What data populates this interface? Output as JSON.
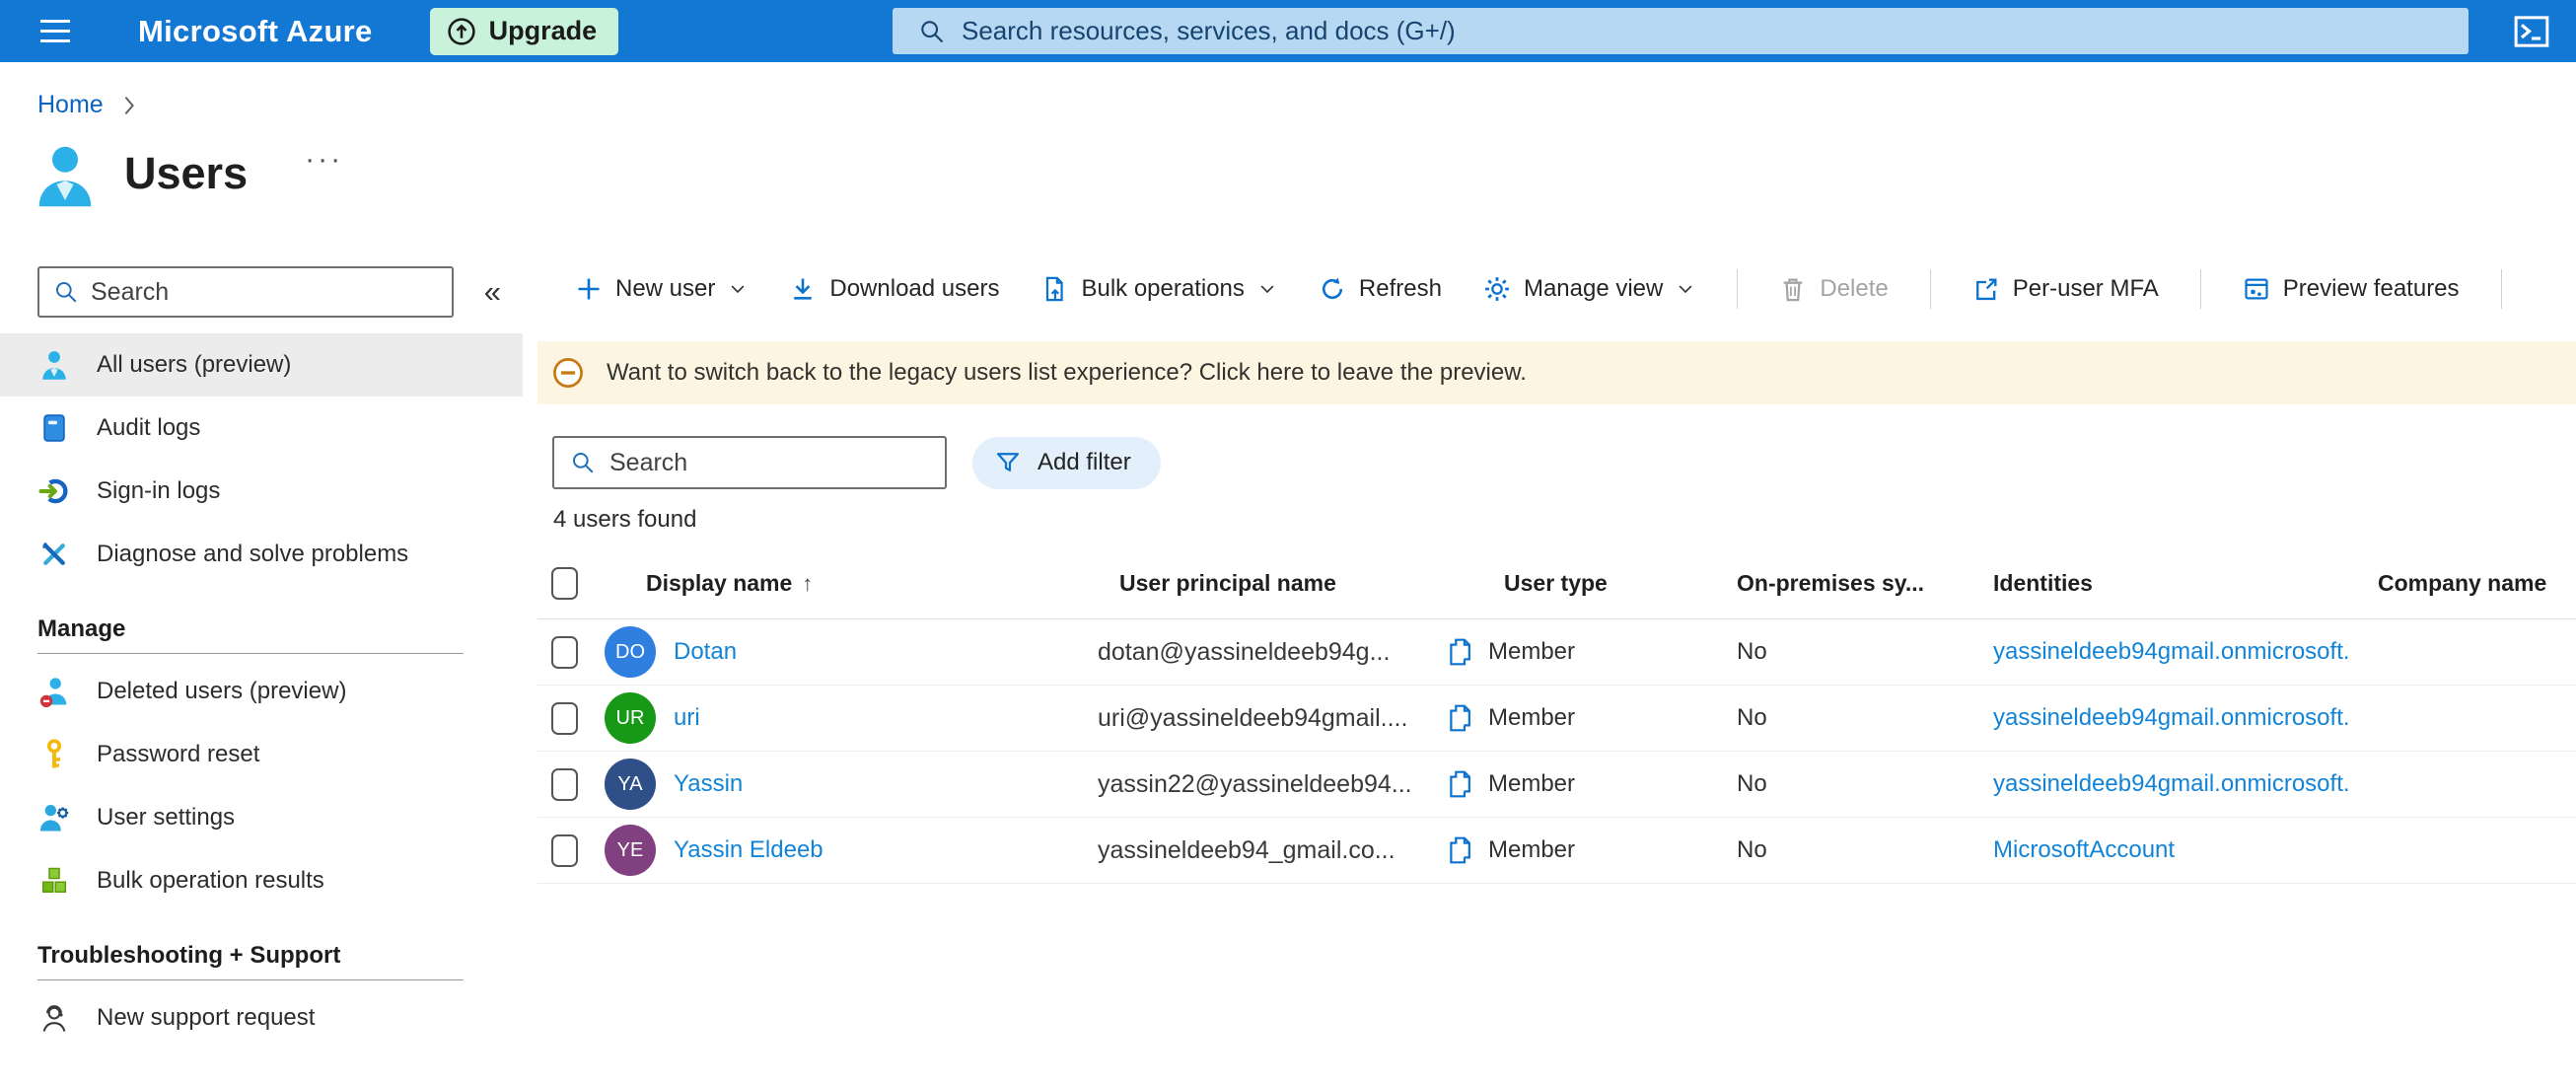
{
  "colors": {
    "topbar_bg": "#1377d4",
    "topbar_search_bg": "#b6d8f2",
    "upgrade_bg": "#c9f2da",
    "accent_blue": "#0b72cf",
    "link_blue": "#1284d7",
    "banner_bg": "#fcf5e2",
    "banner_icon": "#c47a11",
    "selected_item_bg": "#ececec"
  },
  "topbar": {
    "brand": "Microsoft Azure",
    "upgrade_label": "Upgrade",
    "search_placeholder": "Search resources, services, and docs (G+/)"
  },
  "breadcrumb": {
    "home": "Home"
  },
  "page": {
    "title": "Users",
    "more": "···"
  },
  "sidebar": {
    "search_placeholder": "Search",
    "collapse": "«",
    "top_items": [
      {
        "label": "All users (preview)"
      },
      {
        "label": "Audit logs"
      },
      {
        "label": "Sign-in logs"
      },
      {
        "label": "Diagnose and solve problems"
      }
    ],
    "manage_header": "Manage",
    "manage_items": [
      {
        "label": "Deleted users (preview)"
      },
      {
        "label": "Password reset"
      },
      {
        "label": "User settings"
      },
      {
        "label": "Bulk operation results"
      }
    ],
    "support_header": "Troubleshooting + Support",
    "support_items": [
      {
        "label": "New support request"
      }
    ]
  },
  "toolbar": {
    "new_user": "New user",
    "download_users": "Download users",
    "bulk_operations": "Bulk operations",
    "refresh": "Refresh",
    "manage_view": "Manage view",
    "delete": "Delete",
    "per_user_mfa": "Per-user MFA",
    "preview_features": "Preview features"
  },
  "banner": {
    "text": "Want to switch back to the legacy users list experience? Click here to leave the preview."
  },
  "filters": {
    "search_placeholder": "Search",
    "add_filter": "Add filter"
  },
  "results_count": "4 users found",
  "table": {
    "headers": {
      "display_name": "Display name",
      "sort_arrow": "↑",
      "upn": "User principal name",
      "user_type": "User type",
      "on_premises": "On-premises sy...",
      "identities": "Identities",
      "company": "Company name"
    },
    "rows": [
      {
        "initials": "DO",
        "avatar_color": "#2f7fe0",
        "display_name": "Dotan",
        "upn": "dotan@yassineldeeb94g...",
        "user_type": "Member",
        "on_premises": "No",
        "identity": "yassineldeeb94gmail.onmicrosoft."
      },
      {
        "initials": "UR",
        "avatar_color": "#179917",
        "display_name": "uri",
        "upn": "uri@yassineldeeb94gmail....",
        "user_type": "Member",
        "on_premises": "No",
        "identity": "yassineldeeb94gmail.onmicrosoft."
      },
      {
        "initials": "YA",
        "avatar_color": "#2e4f87",
        "display_name": "Yassin",
        "upn": "yassin22@yassineldeeb94...",
        "user_type": "Member",
        "on_premises": "No",
        "identity": "yassineldeeb94gmail.onmicrosoft."
      },
      {
        "initials": "YE",
        "avatar_color": "#81407f",
        "display_name": "Yassin Eldeeb",
        "upn": "yassineldeeb94_gmail.co...",
        "user_type": "Member",
        "on_premises": "No",
        "identity": "MicrosoftAccount"
      }
    ]
  }
}
